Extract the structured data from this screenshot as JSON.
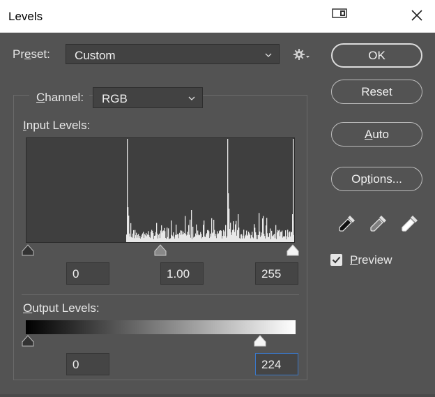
{
  "window": {
    "title": "Levels"
  },
  "preset": {
    "label_prefix": "Pr",
    "label_ul": "e",
    "label_suffix": "set:",
    "value": "Custom"
  },
  "channel": {
    "label_ul": "C",
    "label_suffix": "hannel:",
    "value": "RGB"
  },
  "input_levels": {
    "label_ul": "I",
    "label_suffix": "nput Levels:",
    "black": "0",
    "gamma": "1.00",
    "white": "255"
  },
  "output_levels": {
    "label_ul": "O",
    "label_suffix": "utput Levels:",
    "black": "0",
    "white": "224"
  },
  "buttons": {
    "ok": "OK",
    "reset": "Reset",
    "auto_ul": "A",
    "auto_suffix": "uto",
    "options_prefix": "Op",
    "options_ul": "t",
    "options_suffix": "ions..."
  },
  "preview": {
    "label_ul": "P",
    "label_suffix": "review",
    "checked": true
  },
  "icons": {
    "settings": "gear-icon",
    "eyedroppers": [
      "black-eyedropper-icon",
      "gray-eyedropper-icon",
      "white-eyedropper-icon"
    ]
  },
  "colors": {
    "dialog_bg": "#535353",
    "focus_border": "#3a78c9"
  }
}
